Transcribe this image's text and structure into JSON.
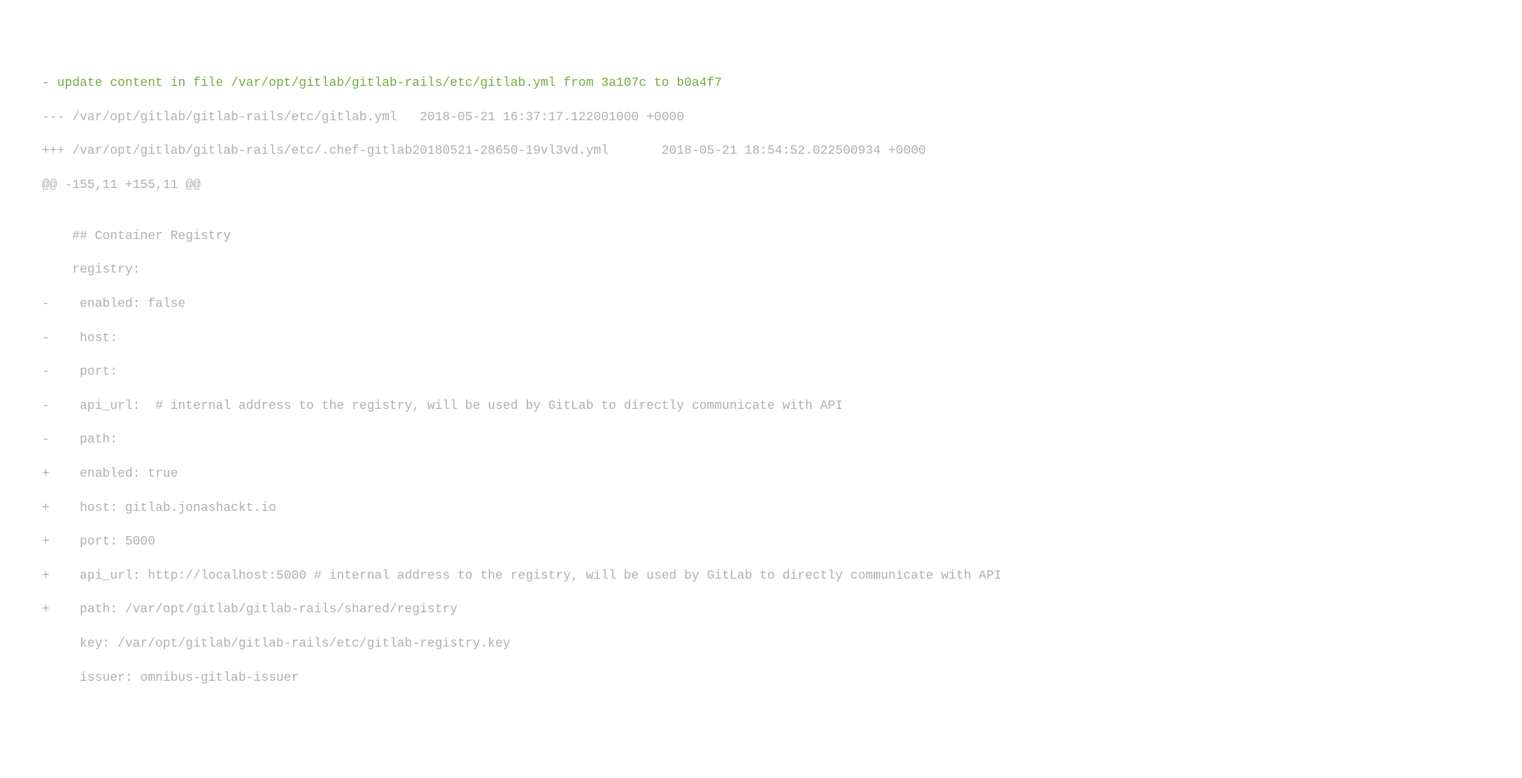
{
  "diff": {
    "header": "- update content in file /var/opt/gitlab/gitlab-rails/etc/gitlab.yml from 3a107c to b0a4f7",
    "old_file": "--- /var/opt/gitlab/gitlab-rails/etc/gitlab.yml   2018-05-21 16:37:17.122001000 +0000",
    "new_file": "+++ /var/opt/gitlab/gitlab-rails/etc/.chef-gitlab20180521-28650-19vl3vd.yml       2018-05-21 18:54:52.022500934 +0000",
    "hunk": "@@ -155,11 +155,11 @@",
    "blank1": "",
    "ctx1": "    ## Container Registry",
    "ctx2": "    registry:",
    "del1": "-    enabled: false",
    "del2": "-    host:",
    "del3": "-    port:",
    "del4": "-    api_url:  # internal address to the registry, will be used by GitLab to directly communicate with API",
    "del5": "-    path:",
    "add1": "+    enabled: true",
    "add2": "+    host: gitlab.jonashackt.io",
    "add3": "+    port: 5000",
    "add4": "+    api_url: http://localhost:5000 # internal address to the registry, will be used by GitLab to directly communicate with API",
    "add5": "+    path: /var/opt/gitlab/gitlab-rails/shared/registry",
    "ctx3": "     key: /var/opt/gitlab/gitlab-rails/etc/gitlab-registry.key",
    "ctx4": "     issuer: omnibus-gitlab-issuer"
  }
}
